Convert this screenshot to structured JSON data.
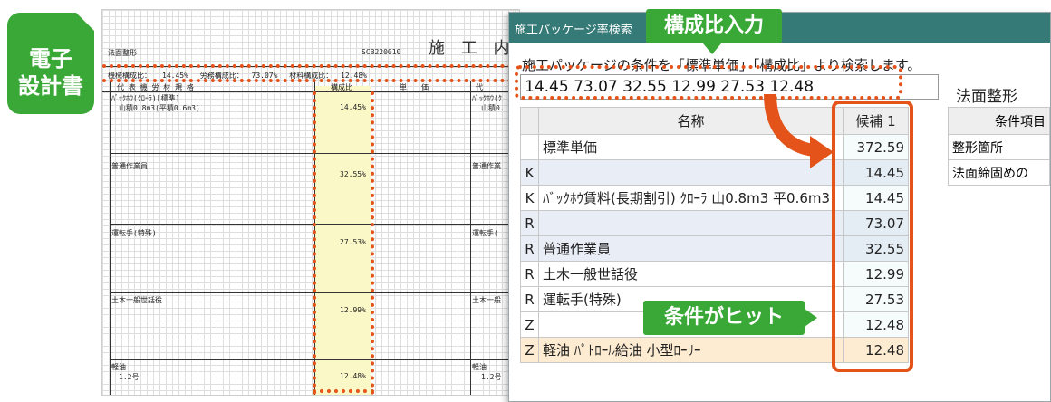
{
  "badge": {
    "line1": "電子",
    "line2": "設計書"
  },
  "sheet": {
    "section": "法面整形",
    "code": "SCB220010",
    "title": "施 工 内",
    "ratios_row": "機械構成比：　　14.45%　 労務構成比：　 73.07%　 材料構成比：　 12.48%",
    "header_spec": "代 表 機 労 材 規 格",
    "header_ratio": "構成比",
    "header_unit": "単　　価",
    "header_right": "代",
    "rows": [
      {
        "name": "ﾊﾞｯｸﾎｳ(ｸﾛｰﾗ)[標準]",
        "spec": "山積0.8m3(平積0.6m3)",
        "ratio": "14.45%",
        "right_name": "ﾊﾞｯｸﾎｳ(ｸ",
        "right_spec": "山積0."
      },
      {
        "name": "普通作業員",
        "spec": "",
        "ratio": "32.55%",
        "right_name": "普通作業",
        "right_spec": ""
      },
      {
        "name": "運転手(特殊)",
        "spec": "",
        "ratio": "27.53%",
        "right_name": "運転手(",
        "right_spec": ""
      },
      {
        "name": "土木一般世話役",
        "spec": "",
        "ratio": "12.99%",
        "right_name": "土木一般",
        "right_spec": ""
      },
      {
        "name": "軽油",
        "spec": "1.2号",
        "ratio": "12.48%",
        "right_name": "軽油",
        "right_spec": "1.2号"
      }
    ]
  },
  "window": {
    "title": "施工パッケージ率検索",
    "instruction": "施工パッケージの条件を「標準単価」「構成比」より検索します。",
    "search_value": "14.45 73.07 32.55 12.99 27.53 12.48",
    "method_label": "法面整形",
    "table": {
      "headers": {
        "kind": "",
        "name": "名称",
        "candidate": "候補 1"
      },
      "rows": [
        {
          "kind": "",
          "name": "標準単価",
          "value": "372.59",
          "style": "normal"
        },
        {
          "kind": "K",
          "name": "",
          "value": "14.45",
          "style": "alt"
        },
        {
          "kind": "K",
          "name": "ﾊﾞｯｸﾎｳ賃料(長期割引) ｸﾛｰﾗ 山0.8m3 平0.6m3",
          "value": "14.45",
          "style": "normal"
        },
        {
          "kind": "R",
          "name": "",
          "value": "73.07",
          "style": "alt"
        },
        {
          "kind": "R",
          "name": "普通作業員",
          "value": "32.55",
          "style": "alt"
        },
        {
          "kind": "R",
          "name": "土木一般世話役",
          "value": "12.99",
          "style": "normal"
        },
        {
          "kind": "R",
          "name": "運転手(特殊)",
          "value": "27.53",
          "style": "normal"
        },
        {
          "kind": "Z",
          "name": "",
          "value": "12.48",
          "style": "normal"
        },
        {
          "kind": "Z",
          "name": "軽油 ﾊﾟﾄﾛｰﾙ給油 小型ﾛｰﾘｰ",
          "value": "12.48",
          "style": "hi"
        }
      ]
    },
    "conditions": {
      "header": "条件項目",
      "rows": [
        "整形箇所",
        "法面締固めの"
      ]
    }
  },
  "callouts": {
    "input": "構成比入力",
    "hit": "条件がヒット"
  },
  "colors": {
    "green": "#3aa837",
    "orange": "#e4541a",
    "teal": "#357a76"
  }
}
